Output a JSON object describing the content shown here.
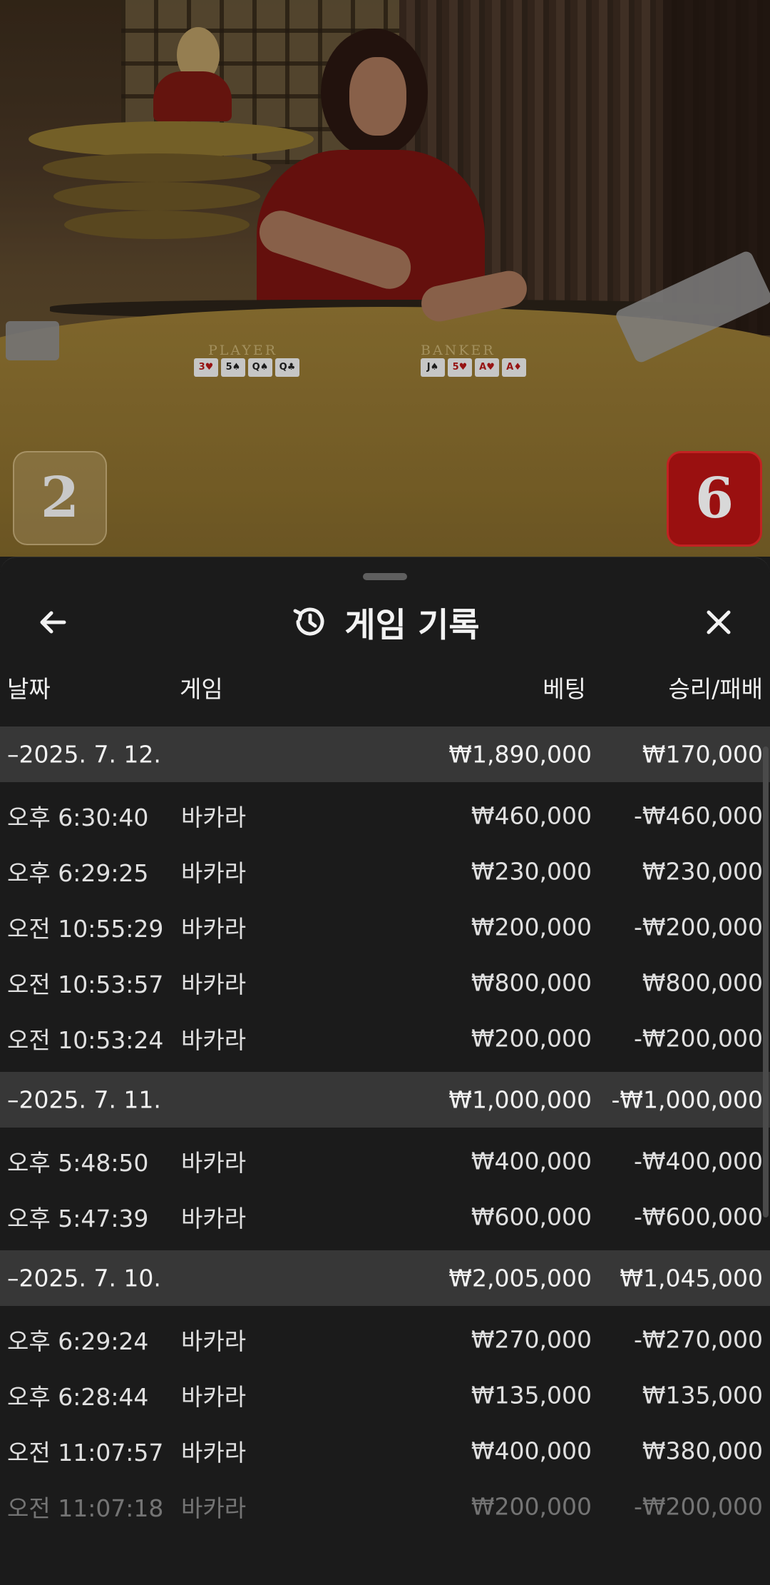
{
  "scores": {
    "player": "2",
    "banker": "6"
  },
  "table": {
    "player_label": "PLAYER",
    "banker_label": "BANKER",
    "player_cards": [
      {
        "rank": "3♥",
        "red": true
      },
      {
        "rank": "5♠",
        "red": false
      },
      {
        "rank": "Q♠",
        "red": false
      },
      {
        "rank": "Q♣",
        "red": false
      }
    ],
    "banker_cards": [
      {
        "rank": "J♠",
        "red": false
      },
      {
        "rank": "5♥",
        "red": true
      },
      {
        "rank": "A♥",
        "red": true
      },
      {
        "rank": "A♦",
        "red": true
      }
    ]
  },
  "sheet": {
    "title": "게임 기록",
    "icons": {
      "back": "arrow-left-icon",
      "history": "history-icon",
      "close": "close-icon"
    },
    "columns": {
      "date": "날짜",
      "game": "게임",
      "bet": "베팅",
      "win_loss": "승리/패배"
    },
    "groups": [
      {
        "date": "–2025. 7. 12.",
        "bet": "₩1,890,000",
        "win_loss": "₩170,000",
        "rows": [
          {
            "time": "오후 6:30:40",
            "game": "바카라",
            "bet": "₩460,000",
            "win_loss": "-₩460,000"
          },
          {
            "time": "오후 6:29:25",
            "game": "바카라",
            "bet": "₩230,000",
            "win_loss": "₩230,000"
          },
          {
            "time": "오전 10:55:29",
            "game": "바카라",
            "bet": "₩200,000",
            "win_loss": "-₩200,000"
          },
          {
            "time": "오전 10:53:57",
            "game": "바카라",
            "bet": "₩800,000",
            "win_loss": "₩800,000"
          },
          {
            "time": "오전 10:53:24",
            "game": "바카라",
            "bet": "₩200,000",
            "win_loss": "-₩200,000"
          }
        ]
      },
      {
        "date": "–2025. 7. 11.",
        "bet": "₩1,000,000",
        "win_loss": "-₩1,000,000",
        "rows": [
          {
            "time": "오후 5:48:50",
            "game": "바카라",
            "bet": "₩400,000",
            "win_loss": "-₩400,000"
          },
          {
            "time": "오후 5:47:39",
            "game": "바카라",
            "bet": "₩600,000",
            "win_loss": "-₩600,000"
          }
        ]
      },
      {
        "date": "–2025. 7. 10.",
        "bet": "₩2,005,000",
        "win_loss": "₩1,045,000",
        "rows": [
          {
            "time": "오후 6:29:24",
            "game": "바카라",
            "bet": "₩270,000",
            "win_loss": "-₩270,000"
          },
          {
            "time": "오후 6:28:44",
            "game": "바카라",
            "bet": "₩135,000",
            "win_loss": "₩135,000"
          },
          {
            "time": "오전 11:07:57",
            "game": "바카라",
            "bet": "₩400,000",
            "win_loss": "₩380,000"
          },
          {
            "time": "오전 11:07:18",
            "game": "바카라",
            "bet": "₩200,000",
            "win_loss": "-₩200,000"
          }
        ]
      }
    ]
  }
}
